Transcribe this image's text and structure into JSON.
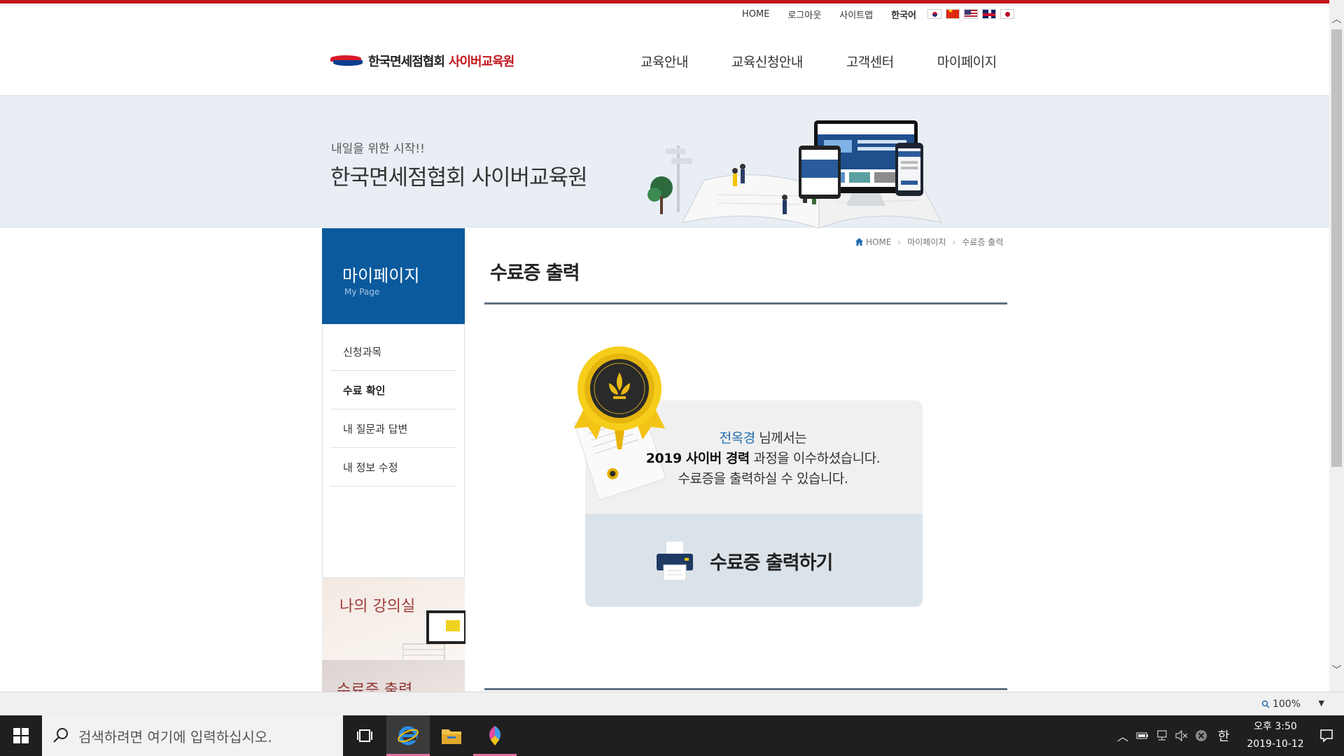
{
  "utility_nav": {
    "home": "HOME",
    "logout": "로그아웃",
    "sitemap": "사이트맵",
    "language": "한국어"
  },
  "logo": {
    "name_main": "한국면세점협회",
    "name_sub": "사이버교육원"
  },
  "gnb": [
    {
      "label": "교육안내"
    },
    {
      "label": "교육신청안내"
    },
    {
      "label": "고객센터"
    },
    {
      "label": "마이페이지"
    }
  ],
  "banner": {
    "subtitle": "내일을 위한 시작!!",
    "title": "한국면세점협회 사이버교육원"
  },
  "sidebar": {
    "title": "마이페이지",
    "subtitle": "My Page",
    "items": [
      {
        "label": "신청과목"
      },
      {
        "label": "수료 확인"
      },
      {
        "label": "내 질문과 답변"
      },
      {
        "label": "내 정보 수정"
      }
    ],
    "card_classroom": "나의 강의실",
    "card_certificate": "수료증 출력"
  },
  "breadcrumb": {
    "home": "HOME",
    "level1": "마이페이지",
    "level2": "수료증 출력"
  },
  "main": {
    "page_title": "수료증 출력",
    "user_name": "전옥경",
    "line1_suffix": " 님께서는",
    "course_name": "2019 사이버 경력",
    "line2_suffix": " 과정을 이수하셨습니다.",
    "line3": "수료증을 출력하실 수 있습니다.",
    "print_button": "수료증 출력하기"
  },
  "statusbar": {
    "zoom": "100%"
  },
  "taskbar": {
    "search_placeholder": "검색하려면 여기에 입력하십시오.",
    "ime": "한",
    "time": "오후 3:50",
    "date": "2019-10-12"
  },
  "colors": {
    "brand_blue": "#0c5a9e",
    "brand_red": "#c4161c",
    "print_box": "#dbe3ea"
  }
}
